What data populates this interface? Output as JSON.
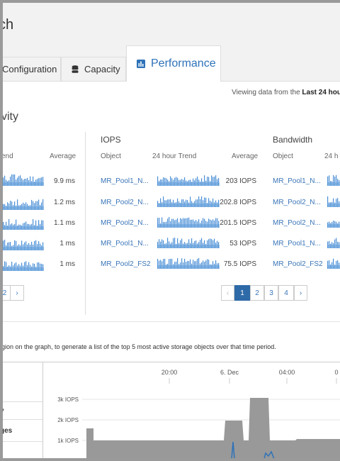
{
  "header": {
    "title": "ch"
  },
  "tabs": {
    "configuration": "Configuration",
    "capacity": "Capacity",
    "performance": "Performance"
  },
  "viewing": {
    "prefix": "Viewing data from the",
    "range": "Last 24 hou"
  },
  "section_title": "vity",
  "latency_panel": {
    "columns": {
      "trend": "end",
      "average": "Average"
    },
    "averages": [
      "9.9 ms",
      "1.2 ms",
      "1.1 ms",
      "1 ms",
      "1 ms"
    ],
    "pagination": [
      "2",
      "›"
    ]
  },
  "iops_panel": {
    "title": "IOPS",
    "columns": {
      "object": "Object",
      "trend": "24 hour Trend",
      "average": "Average"
    },
    "rows": [
      {
        "object": "MR_Pool1_N...",
        "average": "203 IOPS"
      },
      {
        "object": "MR_Pool2_N...",
        "average": "202.8 IOPS"
      },
      {
        "object": "MR_Pool2_N...",
        "average": "201.5 IOPS"
      },
      {
        "object": "MR_Pool1_N...",
        "average": "53 IOPS"
      },
      {
        "object": "MR_Pool2_FS2",
        "average": "75.5 IOPS"
      }
    ],
    "pagination": {
      "prev": "‹",
      "pages": [
        "1",
        "2",
        "3",
        "4"
      ],
      "next": "›",
      "active_page": 1
    }
  },
  "bandwidth_panel": {
    "title": "Bandwidth",
    "columns": {
      "object": "Object",
      "trend": "24 h"
    },
    "rows": [
      "MR_Pool1_N...",
      "MR_Pool2_N...",
      "MR_Pool2_N...",
      "MR_Pool1_N...",
      "MR_Pool2_FS2"
    ]
  },
  "instruction": "gion on the graph, to generate a list of the top 5 most active storage objects over that time period.",
  "timeline": {
    "left_items": [
      "y",
      "ges"
    ],
    "x_ticks": [
      "20:00",
      "6. Dec",
      "04:00",
      "0"
    ],
    "y_ticks": [
      "3k IOPS",
      "2k IOPS",
      "1k IOPS"
    ]
  },
  "colors": {
    "accent": "#2e72b8",
    "spark": "#4a8fd6",
    "area": "#999999"
  },
  "icons": {
    "capacity_tab": "database-icon",
    "performance_tab": "bar-chart-icon"
  }
}
